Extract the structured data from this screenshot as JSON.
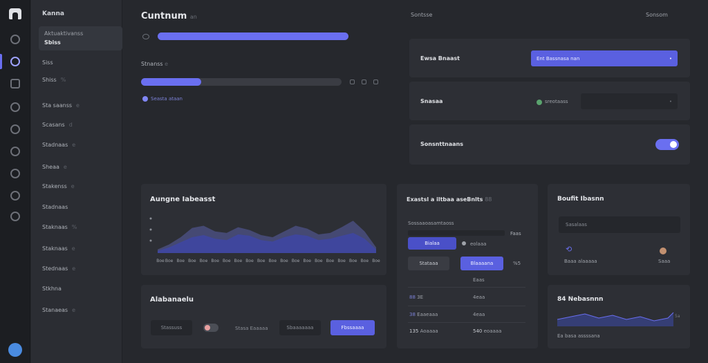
{
  "sidebar": {
    "title": "Kanna",
    "card": {
      "line1": "Aktuaktivanss",
      "line2": "Sbiss"
    },
    "items": [
      {
        "label": "Siss",
        "dim": ""
      },
      {
        "label": "Shiss",
        "dim": "%"
      },
      {
        "label": "Sta saanss",
        "dim": "e"
      },
      {
        "label": "Scasans",
        "dim": "d",
        "badge": "5%"
      },
      {
        "label": "Stadnaas",
        "dim": "e"
      },
      {
        "label": "Sheaa",
        "dim": "e"
      },
      {
        "label": "Stakenss",
        "dim": "e",
        "badge": "8"
      },
      {
        "label": "Stadnaas",
        "dim": ""
      },
      {
        "label": "Staknaas",
        "dim": "%"
      },
      {
        "label": "Staknaas",
        "dim": "e"
      },
      {
        "label": "Stednaas",
        "dim": "e"
      },
      {
        "label": "Stkhna",
        "dim": ""
      },
      {
        "label": "Stanaeas",
        "dim": "e"
      }
    ]
  },
  "header": {
    "title": "Cuntnum",
    "title_suffix": "an",
    "center_label": "Sontsse",
    "right_label": "Sonsom"
  },
  "progress": {
    "label": "Stnanss",
    "label_suffix": "e",
    "top_fill": 1.0,
    "bottom_fill": 0.3,
    "note": "Seasta ataan"
  },
  "settings": {
    "row1_label": "Ewsa Bnaast",
    "row1_value": "Ent Bassnasa nan",
    "row2_label": "Snasaa",
    "row2_value": "sreotaass",
    "row3_label": "Sonsnttnaans",
    "row3_toggle": true
  },
  "chart": {
    "title": "Aungne Iabeasst",
    "xlabels": [
      "Boe",
      "Boe",
      "Boe",
      "Boe",
      "Boe",
      "Boe",
      "Boe",
      "Boe",
      "Boe",
      "Boe",
      "Boe",
      "Boe",
      "Boe",
      "Boe",
      "Boe",
      "Boe",
      "Boe",
      "Boe",
      "Boe",
      "Boe"
    ]
  },
  "chart_data": {
    "type": "area",
    "categories": [
      "Boe",
      "Boe",
      "Boe",
      "Boe",
      "Boe",
      "Boe",
      "Boe",
      "Boe",
      "Boe",
      "Boe",
      "Boe",
      "Boe",
      "Boe",
      "Boe",
      "Boe",
      "Boe",
      "Boe",
      "Boe",
      "Boe",
      "Boe"
    ],
    "series": [
      {
        "values": [
          5,
          12,
          22,
          35,
          38,
          30,
          28,
          36,
          32,
          25,
          22,
          30,
          38,
          34,
          26,
          28,
          36,
          45,
          30,
          8
        ]
      },
      {
        "values": [
          3,
          8,
          15,
          22,
          25,
          20,
          18,
          26,
          24,
          18,
          16,
          22,
          26,
          24,
          18,
          20,
          24,
          28,
          20,
          5
        ]
      }
    ]
  },
  "mid_panel": {
    "title": "Exastsl a iltbaa aseBnlts",
    "title_suffix": "88",
    "subtitle": "Sossaaoasamtaoss",
    "sub_right": "Faas",
    "btn1": "Bialaa",
    "btn1_side": "eolaaa",
    "btn2": "Stataaa",
    "btn3": "Blaaaana",
    "btn3_side": "%5",
    "row1": "Eaas",
    "row2_l": "88",
    "row2_lt": "3E",
    "row2_r": "4eaa",
    "row3_l": "38",
    "row3_lt": "Eaaeaaa",
    "row3_r": "4eaa",
    "row4_l": "135",
    "row4_lt": "Aoaaaa",
    "row4_r": "540",
    "row4_rt": "eoaaaa"
  },
  "right_top": {
    "title": "Boufit Ibasnn",
    "input": "Sasalaas",
    "left_label": "Baaa alaaaaa",
    "right_label": "Saaa"
  },
  "right_bottom": {
    "title_num": "84",
    "title": "Nebasnnn",
    "axis_label": "5a",
    "caption": "Ea basa assssana"
  },
  "bottom_panel": {
    "title": "Alabanaelu",
    "field1": "Stassuss",
    "field2": "Stasa Eaaaaa",
    "field3": "Sbaaaaaaa",
    "button": "Fbssaaaa"
  },
  "colors": {
    "accent": "#6a6ff0",
    "panel": "#2d2f35",
    "bg": "#26282d"
  }
}
